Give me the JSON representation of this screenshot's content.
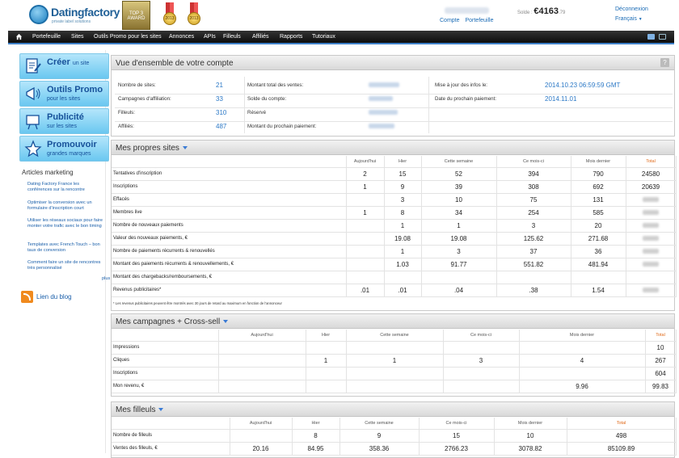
{
  "header": {
    "brand": "Datingfactory",
    "tagline": "private label solutions",
    "award_label": "TOP 3 AWARD",
    "medal1_label": "2013",
    "medal2_label": "2013",
    "account_links": [
      "Compte",
      "Portefeuille"
    ],
    "solde_label": "Solde :",
    "solde_amount": "€4163",
    "solde_cents": ".79",
    "logout": "Déconnexion",
    "language": "Français"
  },
  "nav": {
    "items": [
      "Portefeuille",
      "Sites",
      "Outils Promo pour les sites",
      "Annonces",
      "APIs",
      "Filleuls",
      "Affiliés",
      "Rapports",
      "Tutoriaux"
    ]
  },
  "sidebar": {
    "buttons": [
      {
        "title": "Créer",
        "title_suffix": "un site",
        "subtitle": "",
        "icon": "document-pen-icon"
      },
      {
        "title": "Outils Promo",
        "title_suffix": "",
        "subtitle": "pour les sites",
        "icon": "megaphone-icon"
      },
      {
        "title": "Publicité",
        "title_suffix": "",
        "subtitle": "sur les sites",
        "icon": "signboard-icon"
      },
      {
        "title": "Promouvoir",
        "title_suffix": "",
        "subtitle": "grandes marques",
        "icon": "star-icon"
      }
    ],
    "articles_title": "Articles marketing",
    "articles": [
      "Dating Factory France les conférences sur la rencontre",
      "Optimiser la conversion avec un formulaire d'inscription court",
      "Utiliser les réseaux sociaux pour faire monter votre trafic avec le bon timing",
      "Templates avec French Touch – bon taux de conversion",
      "Comment faire un site de rencontres très personnalisé"
    ],
    "more": "plus",
    "blog": "Lien du blog"
  },
  "overview": {
    "title": "Vue d'ensemble de votre compte",
    "help": "?",
    "col1": [
      {
        "label": "Nombre de sites:",
        "value": "21"
      },
      {
        "label": "Campagnes d'affiliation:",
        "value": "33"
      },
      {
        "label": "Filleuls:",
        "value": "310"
      },
      {
        "label": "Affiliés:",
        "value": "487"
      }
    ],
    "col2": [
      "Montant total des ventes:",
      "Solde du compte:",
      "Réservé",
      "Montant du prochain paiement:"
    ],
    "col3": [
      {
        "label": "Mise à jour des infos le:",
        "value": "2014.10.23 06:59:59 GMT"
      },
      {
        "label": "Date du prochain paiement:",
        "value": "2014.11.01"
      }
    ]
  },
  "sites": {
    "title": "Mes propres sites",
    "headers": [
      "Aujourd'hui",
      "Hier",
      "Cette semaine",
      "Ce mois-ci",
      "Mois dernier",
      "Total"
    ],
    "rows": [
      {
        "label": "Tentatives d'inscription",
        "cells": [
          "2",
          "15",
          "52",
          "394",
          "790",
          "24580"
        ]
      },
      {
        "label": "Inscriptions",
        "cells": [
          "1",
          "9",
          "39",
          "308",
          "692",
          "20639"
        ]
      },
      {
        "label": "Effacés",
        "cells": [
          "",
          "3",
          "10",
          "75",
          "131",
          "#"
        ]
      },
      {
        "label": "Membres live",
        "cells": [
          "1",
          "8",
          "34",
          "254",
          "585",
          "#"
        ]
      },
      {
        "label": "Nombre de nouveaux paiements",
        "cells": [
          "",
          "1",
          "1",
          "3",
          "20",
          "#"
        ]
      },
      {
        "label": "Valeur des nouveaux paiements, €",
        "cells": [
          "",
          "19.08",
          "19.08",
          "125.62",
          "271.68",
          "#"
        ]
      },
      {
        "label": "Nombre de paiements récurrents & renouvellés",
        "cells": [
          "",
          "1",
          "3",
          "37",
          "36",
          "#"
        ]
      },
      {
        "label": "Montant des paiements récurrents & renouvellements, €",
        "cells": [
          "",
          "1.03",
          "91.77",
          "551.82",
          "481.94",
          "#"
        ]
      },
      {
        "label": "Montant des chargebacks/remboursements, €",
        "cells": [
          "",
          "",
          "",
          "",
          "",
          ""
        ]
      },
      {
        "label": "Revenus publicitaires*",
        "cells": [
          ".01",
          ".01",
          ".04",
          ".38",
          "1.54",
          "#"
        ]
      }
    ],
    "footnote": "* Les revenus publicitaires peuvent être montrés avec 30 jours de retard au maximum en fonction de l'annonceur"
  },
  "campaigns": {
    "title": "Mes campagnes + Cross-sell",
    "headers": [
      "Aujourd'hui",
      "Hier",
      "Cette semaine",
      "Ce mois-ci",
      "Mois dernier",
      "Total"
    ],
    "rows": [
      {
        "label": "Impressions",
        "cells": [
          "",
          "",
          "",
          "",
          "",
          "10"
        ]
      },
      {
        "label": "Cliques",
        "cells": [
          "",
          "1",
          "1",
          "3",
          "4",
          "267"
        ]
      },
      {
        "label": "Inscriptions",
        "cells": [
          "",
          "",
          "",
          "",
          "",
          "604"
        ]
      },
      {
        "label": "Mon revenu, €",
        "cells": [
          "",
          "",
          "",
          "",
          "9.96",
          "99.83"
        ]
      }
    ]
  },
  "referrals": {
    "title": "Mes filleuls",
    "headers": [
      "Aujourd'hui",
      "Hier",
      "Cette semaine",
      "Ce mois-ci",
      "Mois dernier",
      "Total"
    ],
    "rows": [
      {
        "label": "Nombre de filleuls",
        "cells": [
          "",
          "8",
          "9",
          "15",
          "10",
          "498"
        ]
      },
      {
        "label": "Ventes des filleuls, €",
        "cells": [
          "20.16",
          "84.95",
          "358.36",
          "2766.23",
          "3078.82",
          "85109.89"
        ]
      }
    ]
  },
  "colors": {
    "accent": "#2b78c6",
    "nav_bg": "#111111",
    "sidebar_btn": "#8fd4f4",
    "total_header": "#e06a1a"
  }
}
